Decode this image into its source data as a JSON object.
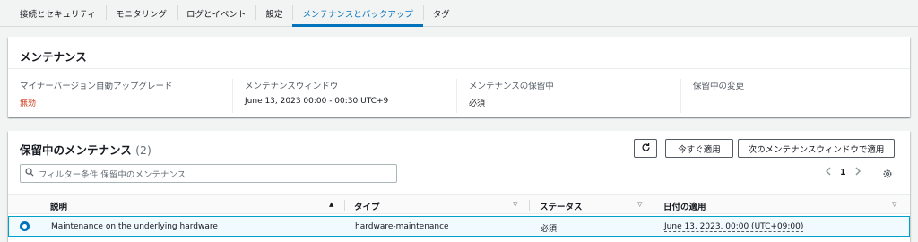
{
  "tabs": [
    {
      "label": "接続とセキュリティ"
    },
    {
      "label": "モニタリング"
    },
    {
      "label": "ログとイベント"
    },
    {
      "label": "設定"
    },
    {
      "label": "メンテナンスとバックアップ",
      "active": true
    },
    {
      "label": "タグ"
    }
  ],
  "maintenance": {
    "title": "メンテナンス",
    "fields": [
      {
        "label": "マイナーバージョン自動アップグレード",
        "value": "無効"
      },
      {
        "label": "メンテナンスウィンドウ",
        "value": "June 13, 2023 00:00 - 00:30 UTC+9"
      },
      {
        "label": "メンテナンスの保留中",
        "value": "必須"
      },
      {
        "label": "保留中の変更",
        "value": ""
      }
    ]
  },
  "pending": {
    "title": "保留中のメンテナンス",
    "count": "(2)",
    "apply_now_label": "今すぐ適用",
    "apply_next_label": "次のメンテナンスウィンドウで適用",
    "search_placeholder": "フィルター条件 保留中のメンテナンス",
    "page": "1",
    "columns": [
      "説明",
      "タイプ",
      "ステータス",
      "日付の適用"
    ],
    "rows": [
      {
        "description": "Maintenance on the underlying hardware",
        "type": "hardware-maintenance",
        "status": "必須",
        "apply_date": "June 13, 2023, 00:00 (UTC+09:00)"
      }
    ]
  },
  "colors": {
    "accent": "#0073bb",
    "disabled_red": "#d13212",
    "selected_row_bg": "#f1faff"
  },
  "icons": [
    "refresh-icon",
    "search-icon",
    "chevron-left-icon",
    "chevron-right-icon",
    "gear-icon",
    "sort-asc-icon",
    "sort-icon"
  ]
}
